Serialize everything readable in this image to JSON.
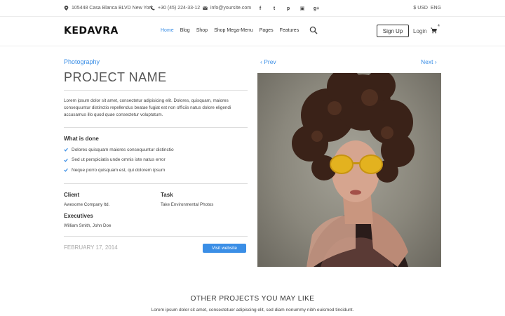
{
  "topbar": {
    "address": "105448 Casa Blanca BLVD New York",
    "phone": "+30 (45) 224-33-12",
    "email": "info@yoursite.com",
    "social": [
      {
        "icon": "facebook-icon",
        "glyph": "f"
      },
      {
        "icon": "twitter-icon",
        "glyph": "t"
      },
      {
        "icon": "pinterest-icon",
        "glyph": "p"
      },
      {
        "icon": "flickr-icon",
        "glyph": "▣"
      },
      {
        "icon": "google-plus-icon",
        "glyph": "g+"
      }
    ],
    "currency": "$ USD",
    "language": "ENG"
  },
  "header": {
    "logo": "KEDAVRA",
    "nav": [
      "Home",
      "Blog",
      "Shop",
      "Shop Mega-Menu",
      "Pages",
      "Features"
    ],
    "signup": "Sign Up",
    "login": "Login",
    "cart_count": "4"
  },
  "project": {
    "category": "Photography",
    "title": "PROJECT NAME",
    "description": "Lorem ipsum dolor sit amet, consectetur adipisicing elit. Dolores, quisquam, maiores consequuntur distinctio repellendus beatae fugiat est non officiis natus dolore eligendi accusamus illo quod quae consectetur voluptatum.",
    "done_heading": "What is done",
    "done_items": [
      "Dolores quisquam maiores consequuntur distinctio",
      "Sed ut perspiciatis unde omnis iste natus error",
      "Neque porro quisquam est, qui dolorem ipsum"
    ],
    "client_label": "Client",
    "client_value": "Awesome Company ltd.",
    "task_label": "Task",
    "task_value": "Take Environmental Photos",
    "executives_label": "Executives",
    "executives_value": "William Smith, John Doe",
    "date": "FEBRUARY 17, 2014",
    "visit_button": "Visit website"
  },
  "pager": {
    "prev": "Prev",
    "next": "Next"
  },
  "other": {
    "title": "OTHER PROJECTS YOU MAY LIKE",
    "subtitle": "Lorem ipsum dolor sit amet, consectetuer adipiscing elit, sed diam nonummy nibh euismod tincidunt."
  },
  "colors": {
    "accent": "#3a8ee6"
  }
}
